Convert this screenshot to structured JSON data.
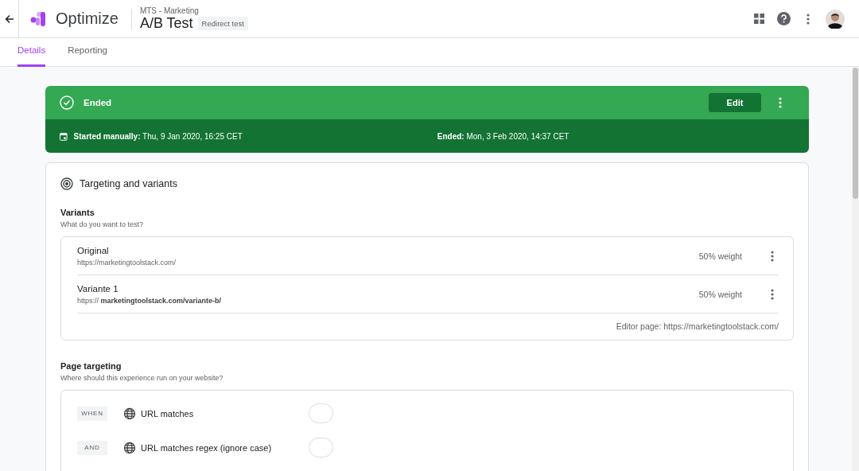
{
  "header": {
    "app_name": "Optimize",
    "container": "MTS - Marketing",
    "title": "A/B Test",
    "badge": "Redirect test"
  },
  "tabs": [
    {
      "label": "Details",
      "selected": true
    },
    {
      "label": "Reporting",
      "selected": false
    }
  ],
  "status": {
    "label": "Ended",
    "edit_button": "Edit",
    "started": "**Started manually:** Thu, 9 Jan 2020, 16:25 CET",
    "ended": "**Ended:** Mon, 3 Feb 2020, 14:37 CET"
  },
  "card": {
    "title": "Targeting and variants",
    "variants": {
      "heading": "Variants",
      "subtitle": "What do you want to test?",
      "items": [
        {
          "name": "Original",
          "url": "https://marketingtoolstack.com/",
          "weight": "50% weight"
        },
        {
          "name": "Variante 1",
          "url": "https:// **marketingtoolstack.com/variante-b/**",
          "weight": "50% weight"
        }
      ],
      "editor_page": "Editor page: https://marketingtoolstack.com/"
    },
    "page_targeting": {
      "heading": "Page targeting",
      "subtitle": "Where should this experience run on your website?",
      "rules": [
        {
          "operator": "WHEN",
          "condition": "URL matches"
        },
        {
          "operator": "AND",
          "condition": "URL matches regex (ignore case)"
        }
      ]
    }
  }
}
